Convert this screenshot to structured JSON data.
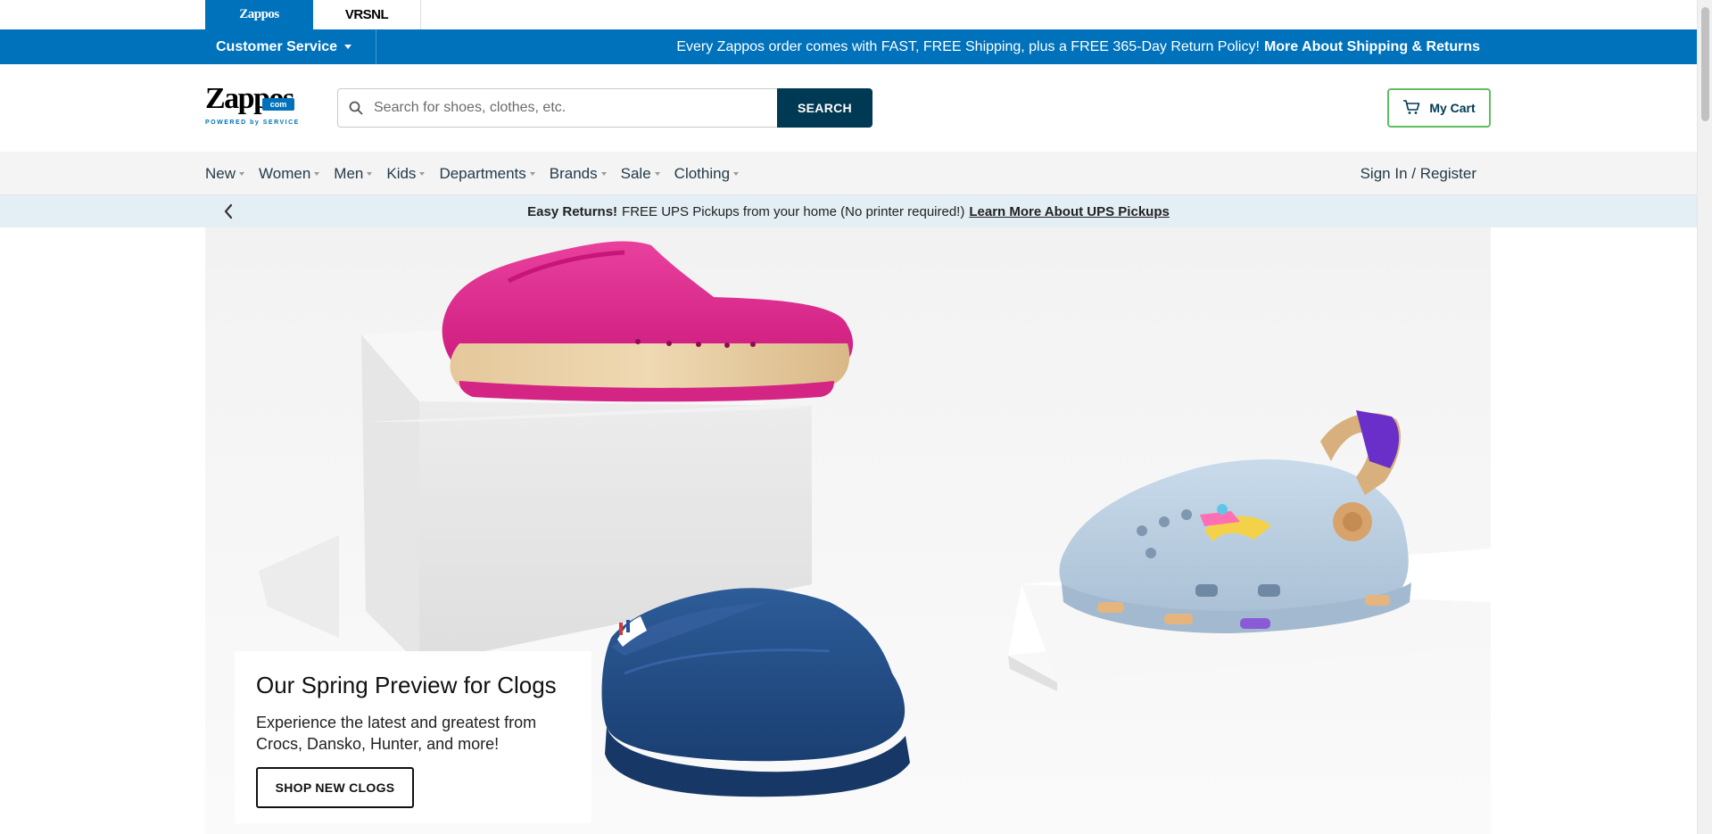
{
  "site_switcher": {
    "zappos_label": "Zappos",
    "vrsnl_label": "VRSNL"
  },
  "top_bar": {
    "customer_service": "Customer Service",
    "shipping_message": "Every Zappos order comes with FAST, FREE Shipping, plus a FREE 365-Day Return Policy!",
    "shipping_link": "More About Shipping & Returns"
  },
  "header": {
    "logo_text": "Zappos",
    "logo_badge": "com",
    "logo_tagline": "POWERED by SERVICE",
    "search_placeholder": "Search for shoes, clothes, etc.",
    "search_button": "SEARCH",
    "cart_label": "My Cart"
  },
  "nav": {
    "items": [
      "New",
      "Women",
      "Men",
      "Kids",
      "Departments",
      "Brands",
      "Sale",
      "Clothing"
    ],
    "sign_in": "Sign In / Register"
  },
  "promo": {
    "bold": "Easy Returns!",
    "text": "FREE UPS Pickups from your home (No printer required!)",
    "link": "Learn More About UPS Pickups"
  },
  "hero": {
    "title": "Our Spring Preview for Clogs",
    "subtitle": "Experience the latest and greatest from Crocs, Dansko, Hunter, and more!",
    "cta": "SHOP NEW CLOGS"
  },
  "colors": {
    "brand_blue": "#0072bc",
    "dark_navy": "#003953",
    "cart_green": "#5fbf5f",
    "pink_clog": "#e0288f",
    "navy_clog": "#1f4b86",
    "light_blue_clog": "#b9cde0"
  }
}
